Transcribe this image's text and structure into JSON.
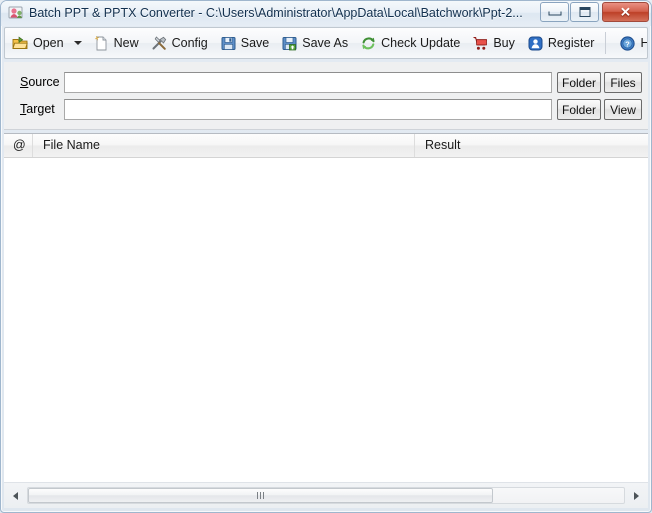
{
  "window": {
    "title": "Batch PPT & PPTX Converter - C:\\Users\\Administrator\\AppData\\Local\\Batchwork\\Ppt-2...",
    "app_icon": "app-icon",
    "caption": {
      "minimize_label": "",
      "maximize_label": "",
      "close_label": "✕"
    }
  },
  "toolbar": {
    "items": [
      {
        "label": "Open",
        "icon": "open-folder-icon",
        "has_dropdown": true
      },
      {
        "label": "New",
        "icon": "new-document-icon",
        "has_dropdown": false
      },
      {
        "label": "Config",
        "icon": "tools-icon",
        "has_dropdown": false
      },
      {
        "label": "Save",
        "icon": "floppy-disk-icon",
        "has_dropdown": false
      },
      {
        "label": "Save As",
        "icon": "save-as-icon",
        "has_dropdown": false
      },
      {
        "label": "Check Update",
        "icon": "refresh-icon",
        "has_dropdown": false
      },
      {
        "label": "Buy",
        "icon": "shopping-cart-icon",
        "has_dropdown": false
      },
      {
        "label": "Register",
        "icon": "register-user-icon",
        "has_dropdown": false
      },
      {
        "label": "He",
        "icon": "help-circle-icon",
        "has_dropdown": false
      },
      {
        "label": "H",
        "icon": "home-icon",
        "has_dropdown": false
      }
    ],
    "separator_before_index": 8
  },
  "form": {
    "source": {
      "label_prefix": "S",
      "label_rest": "ource",
      "value": "",
      "placeholder": "",
      "folder_button": "Folder",
      "action_button": "Files"
    },
    "target": {
      "label_prefix": "T",
      "label_rest": "arget",
      "value": "",
      "placeholder": "",
      "folder_button": "Folder",
      "action_button": "View"
    }
  },
  "list": {
    "columns": [
      {
        "label": "@"
      },
      {
        "label": "File Name"
      },
      {
        "label": "Result"
      }
    ],
    "rows": []
  },
  "scrollbar": {
    "left_arrow": "scroll-left-arrow",
    "right_arrow": "scroll-right-arrow",
    "thumb": "scroll-thumb"
  },
  "colors": {
    "accent": "#2f5d8f",
    "close_button": "#bd4027",
    "panel": "#eff0f1",
    "list_background": "#ffffff"
  }
}
